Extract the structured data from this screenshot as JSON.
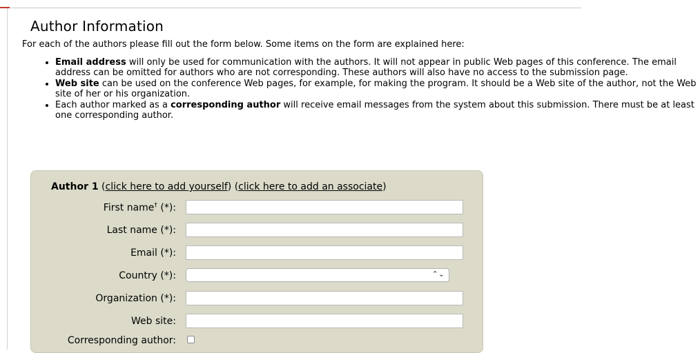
{
  "page": {
    "title": "Author Information",
    "intro": "For each of the authors please fill out the form below. Some items on the form are explained here:",
    "notes": [
      {
        "bold": "Email address",
        "text": " will only be used for communication with the authors. It will not appear in public Web pages of this conference. The email address can be omitted for authors who are not corresponding. These authors will also have no access to the submission page."
      },
      {
        "bold": "Web site",
        "text": " can be used on the conference Web pages, for example, for making the program. It should be a Web site of the author, not the Web site of her or his organization."
      },
      {
        "prefix": "Each author marked as a ",
        "bold": "corresponding author",
        "text": " will receive email messages from the system about this submission. There must be at least one corresponding author."
      }
    ]
  },
  "author_form": {
    "heading": "Author 1",
    "add_yourself_link": "click here to add yourself",
    "add_associate_link": "click here to add an associate",
    "fields": {
      "first_name_label": "First name",
      "first_name_marker": "†",
      "first_name_required": "(*):",
      "last_name_label": "Last name (*):",
      "email_label": "Email (*):",
      "country_label": "Country (*):",
      "country_value": "",
      "country_arrows": "⌃⌄",
      "organization_label": "Organization (*):",
      "web_site_label": "Web site:",
      "corresponding_label": "Corresponding author:",
      "first_name_value": "",
      "last_name_value": "",
      "email_value": "",
      "organization_value": "",
      "web_site_value": ""
    }
  }
}
